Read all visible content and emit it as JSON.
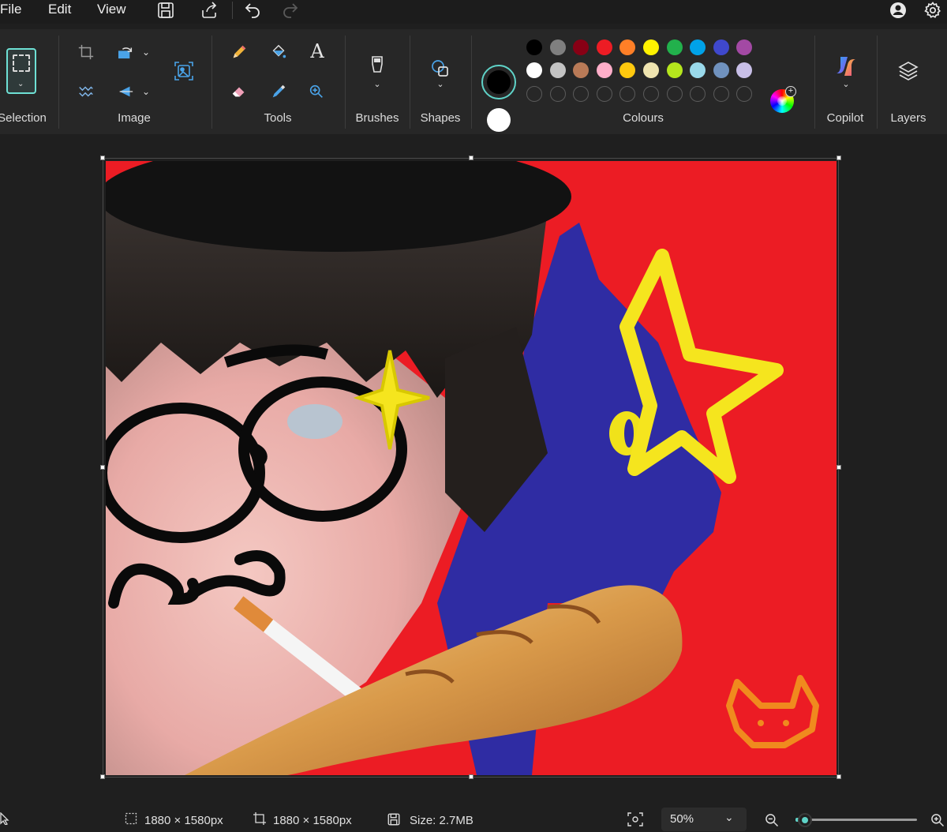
{
  "menubar": {
    "file": "File",
    "edit": "Edit",
    "view": "View"
  },
  "ribbon": {
    "selection_label": "Selection",
    "image_label": "Image",
    "tools_label": "Tools",
    "brushes_label": "Brushes",
    "shapes_label": "Shapes",
    "colours_label": "Colours",
    "copilot_label": "Copilot",
    "layers_label": "Layers"
  },
  "colours": {
    "primary": "#000000",
    "secondary": "#ffffff",
    "row1": [
      "#000000",
      "#7f7f7f",
      "#880015",
      "#ed1c24",
      "#ff7f27",
      "#fff200",
      "#22b14c",
      "#00a2e8",
      "#3f48cc",
      "#a349a4"
    ],
    "row2": [
      "#ffffff",
      "#c3c3c3",
      "#b97a57",
      "#ffaec9",
      "#ffc90e",
      "#efe4b0",
      "#b5e61d",
      "#99d9ea",
      "#7092be",
      "#c8bfe7"
    ],
    "accent": "#5fd3c8"
  },
  "status": {
    "selection_size": "1880 × 1580px",
    "canvas_size": "1880 × 1580px",
    "file_size": "Size: 2.7MB",
    "zoom": "50%",
    "zoom_fraction": 0.08
  }
}
